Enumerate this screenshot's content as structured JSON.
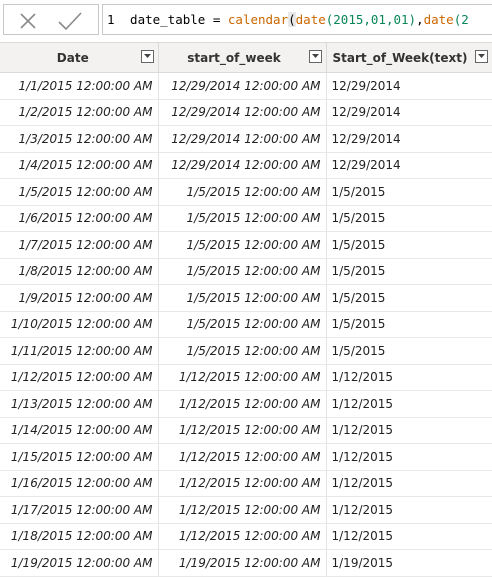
{
  "formula_bar": {
    "line_number": "1",
    "expr_plain_start": " date_table = ",
    "expr_fn_calendar": "calendar",
    "expr_paren_open": "(",
    "expr_fn_date1": "date",
    "expr_args1": "(2015,01,01)",
    "expr_comma": ",",
    "expr_fn_date2": "date",
    "expr_paren_tail": "(2"
  },
  "table": {
    "columns": [
      {
        "label": "Date",
        "key": "date"
      },
      {
        "label": "start_of_week",
        "key": "start_of_week"
      },
      {
        "label": "Start_of_Week(text)",
        "key": "start_of_week_text"
      }
    ],
    "rows": [
      {
        "date": "1/1/2015 12:00:00 AM",
        "start_of_week": "12/29/2014 12:00:00 AM",
        "start_of_week_text": "12/29/2014"
      },
      {
        "date": "1/2/2015 12:00:00 AM",
        "start_of_week": "12/29/2014 12:00:00 AM",
        "start_of_week_text": "12/29/2014"
      },
      {
        "date": "1/3/2015 12:00:00 AM",
        "start_of_week": "12/29/2014 12:00:00 AM",
        "start_of_week_text": "12/29/2014"
      },
      {
        "date": "1/4/2015 12:00:00 AM",
        "start_of_week": "12/29/2014 12:00:00 AM",
        "start_of_week_text": "12/29/2014"
      },
      {
        "date": "1/5/2015 12:00:00 AM",
        "start_of_week": "1/5/2015 12:00:00 AM",
        "start_of_week_text": "1/5/2015"
      },
      {
        "date": "1/6/2015 12:00:00 AM",
        "start_of_week": "1/5/2015 12:00:00 AM",
        "start_of_week_text": "1/5/2015"
      },
      {
        "date": "1/7/2015 12:00:00 AM",
        "start_of_week": "1/5/2015 12:00:00 AM",
        "start_of_week_text": "1/5/2015"
      },
      {
        "date": "1/8/2015 12:00:00 AM",
        "start_of_week": "1/5/2015 12:00:00 AM",
        "start_of_week_text": "1/5/2015"
      },
      {
        "date": "1/9/2015 12:00:00 AM",
        "start_of_week": "1/5/2015 12:00:00 AM",
        "start_of_week_text": "1/5/2015"
      },
      {
        "date": "1/10/2015 12:00:00 AM",
        "start_of_week": "1/5/2015 12:00:00 AM",
        "start_of_week_text": "1/5/2015"
      },
      {
        "date": "1/11/2015 12:00:00 AM",
        "start_of_week": "1/5/2015 12:00:00 AM",
        "start_of_week_text": "1/5/2015"
      },
      {
        "date": "1/12/2015 12:00:00 AM",
        "start_of_week": "1/12/2015 12:00:00 AM",
        "start_of_week_text": "1/12/2015"
      },
      {
        "date": "1/13/2015 12:00:00 AM",
        "start_of_week": "1/12/2015 12:00:00 AM",
        "start_of_week_text": "1/12/2015"
      },
      {
        "date": "1/14/2015 12:00:00 AM",
        "start_of_week": "1/12/2015 12:00:00 AM",
        "start_of_week_text": "1/12/2015"
      },
      {
        "date": "1/15/2015 12:00:00 AM",
        "start_of_week": "1/12/2015 12:00:00 AM",
        "start_of_week_text": "1/12/2015"
      },
      {
        "date": "1/16/2015 12:00:00 AM",
        "start_of_week": "1/12/2015 12:00:00 AM",
        "start_of_week_text": "1/12/2015"
      },
      {
        "date": "1/17/2015 12:00:00 AM",
        "start_of_week": "1/12/2015 12:00:00 AM",
        "start_of_week_text": "1/12/2015"
      },
      {
        "date": "1/18/2015 12:00:00 AM",
        "start_of_week": "1/12/2015 12:00:00 AM",
        "start_of_week_text": "1/12/2015"
      },
      {
        "date": "1/19/2015 12:00:00 AM",
        "start_of_week": "1/19/2015 12:00:00 AM",
        "start_of_week_text": "1/19/2015"
      }
    ]
  },
  "icons": {
    "cancel": "close-icon",
    "commit": "check-icon",
    "filter": "chevron-down-icon"
  },
  "colors": {
    "function_token": "#cc6600",
    "number_token": "#098658",
    "header_bg": "#f3f2f1"
  }
}
